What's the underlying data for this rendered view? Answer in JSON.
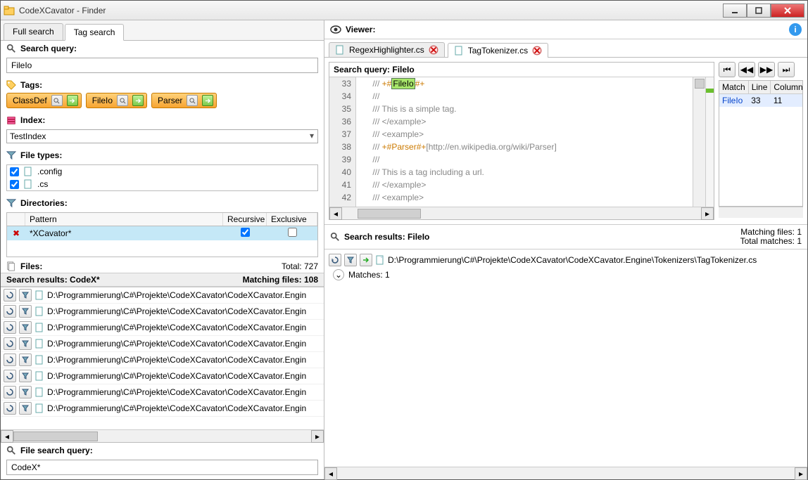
{
  "window": {
    "title": "CodeXCavator - Finder"
  },
  "tabs": {
    "full_search": "Full search",
    "tag_search": "Tag search"
  },
  "search": {
    "query_label": "Search query:",
    "query_value": "FileIo",
    "tags_label": "Tags:",
    "tag_buttons": [
      "ClassDef",
      "FileIo",
      "Parser"
    ],
    "index_label": "Index:",
    "index_value": "TestIndex"
  },
  "filetypes": {
    "label": "File types:",
    "items": [
      {
        "ext": ".config",
        "checked": true
      },
      {
        "ext": ".cs",
        "checked": true
      }
    ]
  },
  "directories": {
    "label": "Directories:",
    "cols": {
      "pattern": "Pattern",
      "recursive": "Recursive",
      "exclusive": "Exclusive"
    },
    "rows": [
      {
        "pattern": "*XCavator*",
        "recursive": true,
        "exclusive": false
      }
    ]
  },
  "files": {
    "label": "Files:",
    "total_label": "Total: 727",
    "results_label": "Search results: CodeX*",
    "matching_label": "Matching files: 108",
    "file_path_prefix": "D:\\Programmierung\\C#\\Projekte\\CodeXCavator\\CodeXCavator.Engin",
    "items": [
      {
        "match": false
      },
      {
        "match": true
      },
      {
        "match": false
      },
      {
        "match": true
      },
      {
        "match": false
      },
      {
        "match": true
      },
      {
        "match": false
      },
      {
        "match": true
      }
    ]
  },
  "file_search": {
    "label": "File search query:",
    "value": "CodeX*"
  },
  "viewer": {
    "label": "Viewer:",
    "tabs": [
      {
        "name": "RegexHighlighter.cs"
      },
      {
        "name": "TagTokenizer.cs"
      }
    ],
    "active_tab": 1,
    "code_query_label": "Search query: FileIo",
    "lines": [
      {
        "n": 33,
        "segments": [
          {
            "t": "/// ",
            "c": "c"
          },
          {
            "t": "+#",
            "c": "tag"
          },
          {
            "t": "FileIo",
            "c": "hl"
          },
          {
            "t": "#+",
            "c": "tag"
          }
        ]
      },
      {
        "n": 34,
        "text": "///"
      },
      {
        "n": 35,
        "text": "/// This is a simple tag."
      },
      {
        "n": 36,
        "text": "/// </example>"
      },
      {
        "n": 37,
        "text": "/// <example>"
      },
      {
        "n": 38,
        "segments": [
          {
            "t": "/// ",
            "c": "c"
          },
          {
            "t": "+#Parser#+",
            "c": "tag"
          },
          {
            "t": "[http://en.wikipedia.org/wiki/Parser]",
            "c": "c"
          }
        ]
      },
      {
        "n": 39,
        "text": "///"
      },
      {
        "n": 40,
        "text": "/// This is a tag including a url."
      },
      {
        "n": 41,
        "text": "/// </example>"
      },
      {
        "n": 42,
        "text": "/// <example>"
      }
    ],
    "match_cols": {
      "match": "Match",
      "line": "Line",
      "column": "Column"
    },
    "match_rows": [
      {
        "match": "FileIo",
        "line": 33,
        "column": 11
      }
    ]
  },
  "results": {
    "label": "Search results: FileIo",
    "matching_files": "Matching files: 1",
    "total_matches": "Total matches: 1",
    "file_path": "D:\\Programmierung\\C#\\Projekte\\CodeXCavator\\CodeXCavator.Engine\\Tokenizers\\TagTokenizer.cs",
    "matches_label": "Matches: 1"
  }
}
